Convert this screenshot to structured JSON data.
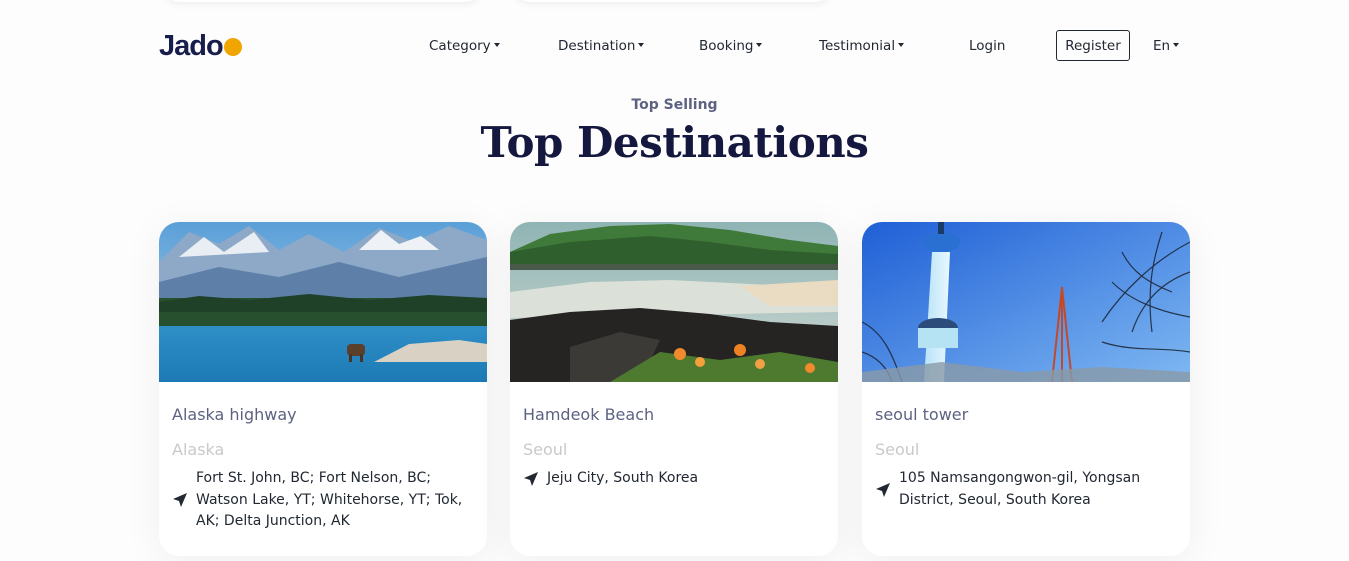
{
  "brand": {
    "logo_text": "Jadoo"
  },
  "nav": {
    "category": "Category",
    "destination": "Destination",
    "booking": "Booking",
    "testimonial": "Testimonial",
    "login": "Login",
    "register": "Register",
    "language": "En"
  },
  "section": {
    "subtitle": "Top Selling",
    "title": "Top Destinations"
  },
  "cards": [
    {
      "name": "Alaska highway",
      "region": "Alaska",
      "location": "Fort St. John, BC; Fort Nelson, BC; Watson Lake, YT; Whitehorse, YT; Tok, AK; Delta Junction, AK",
      "icon": "location-arrow-icon"
    },
    {
      "name": "Hamdeok Beach",
      "region": "Seoul",
      "location": "Jeju City, South Korea",
      "icon": "location-arrow-icon"
    },
    {
      "name": "seoul tower",
      "region": "Seoul",
      "location": "105 Namsangongwon-gil, Yongsan District, Seoul, South Korea",
      "icon": "location-arrow-icon"
    }
  ],
  "colors": {
    "heading": "#14183e",
    "accent": "#f1a501",
    "muted": "#5e6282",
    "faint": "#c9c9c9"
  }
}
